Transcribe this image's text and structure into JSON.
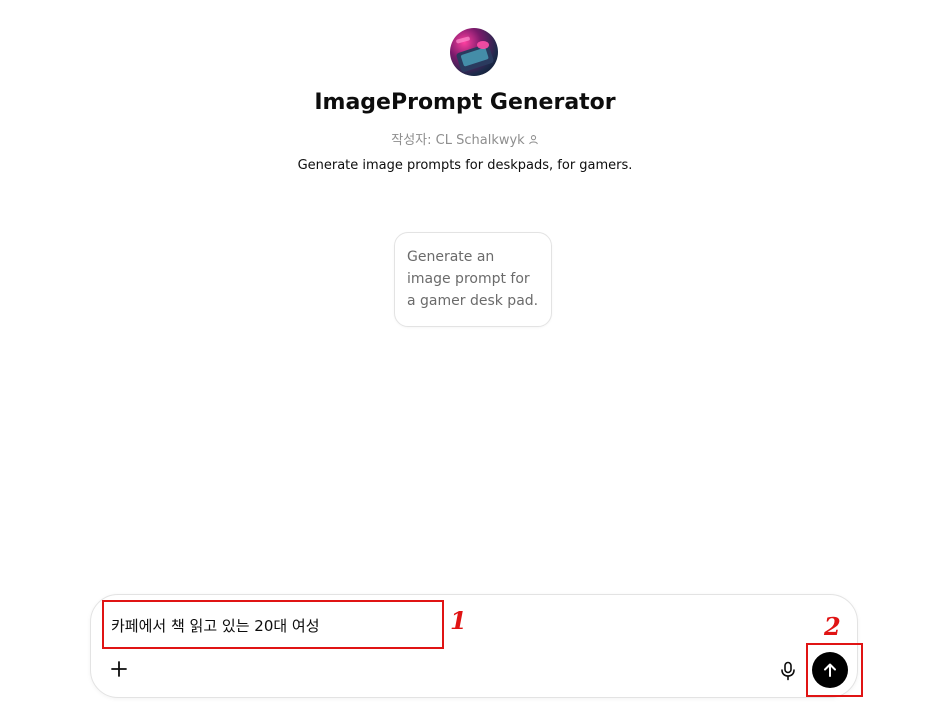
{
  "gpt": {
    "avatar_icon": "gamer-desk-avatar-icon",
    "title": "ImagePrompt Generator",
    "author_label": "작성자: CL Schalkwyk",
    "author_icon": "person-icon",
    "description": "Generate image prompts for deskpads, for gamers."
  },
  "suggestions": [
    {
      "text": "Generate an image prompt for a gamer desk pad."
    }
  ],
  "composer": {
    "input_value": "카페에서 책 읽고 있는 20대 여성",
    "plus_icon": "plus-icon",
    "mic_icon": "microphone-icon",
    "send_icon": "arrow-up-icon"
  },
  "annotations": {
    "label_1": "1",
    "label_2": "2",
    "color": "#e01414"
  },
  "colors": {
    "send_button": "#000000",
    "muted_text": "#8e8e8e",
    "border": "#e3e3e3"
  }
}
